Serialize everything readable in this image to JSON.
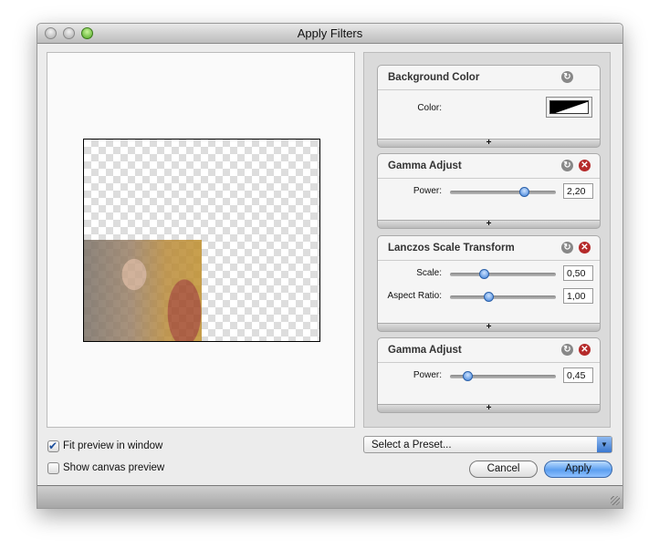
{
  "window": {
    "title": "Apply Filters"
  },
  "filters": [
    {
      "title": "Background Color",
      "deletable": false,
      "params": [
        {
          "label": "Color:",
          "type": "color"
        }
      ]
    },
    {
      "title": "Gamma Adjust",
      "deletable": true,
      "params": [
        {
          "label": "Power:",
          "value": "2,20",
          "slider": 0.7
        }
      ]
    },
    {
      "title": "Lanczos Scale Transform",
      "deletable": true,
      "params": [
        {
          "label": "Scale:",
          "value": "0,50",
          "slider": 0.32
        },
        {
          "label": "Aspect Ratio:",
          "value": "1,00",
          "slider": 0.36
        }
      ]
    },
    {
      "title": "Gamma Adjust",
      "deletable": true,
      "params": [
        {
          "label": "Power:",
          "value": "0,45",
          "slider": 0.16
        }
      ]
    }
  ],
  "options": {
    "fit_preview": {
      "label": "Fit preview in window",
      "checked": true
    },
    "canvas_preview": {
      "label": "Show canvas preview",
      "checked": false
    }
  },
  "preset": {
    "value": "Select a Preset..."
  },
  "buttons": {
    "cancel": "Cancel",
    "apply": "Apply"
  },
  "icons": {
    "reset": "reset-arrow-icon",
    "delete": "delete-x-icon",
    "add": "plus-icon"
  }
}
